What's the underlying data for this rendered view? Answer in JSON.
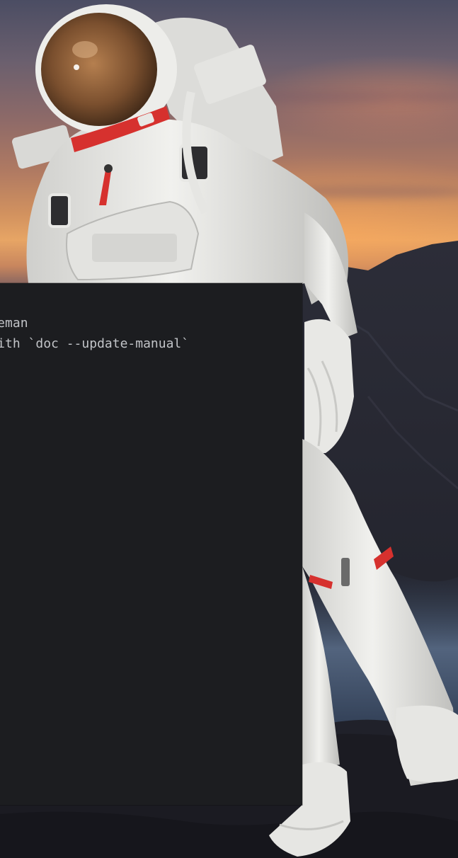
{
  "terminal": {
    "lines": [
      "  tileman",
      "  e with `doc --update-manual`"
    ]
  },
  "colors": {
    "terminal_background": "#1c1d20",
    "terminal_text": "#c2c4c8",
    "sky_sunset": "#e7a565",
    "mountain_dark": "#23252f",
    "suit_white": "#e9e9e6",
    "suit_red": "#d6312e"
  },
  "wallpaper": {
    "subject": "astronaut-floating-over-mountains-at-sunset"
  }
}
